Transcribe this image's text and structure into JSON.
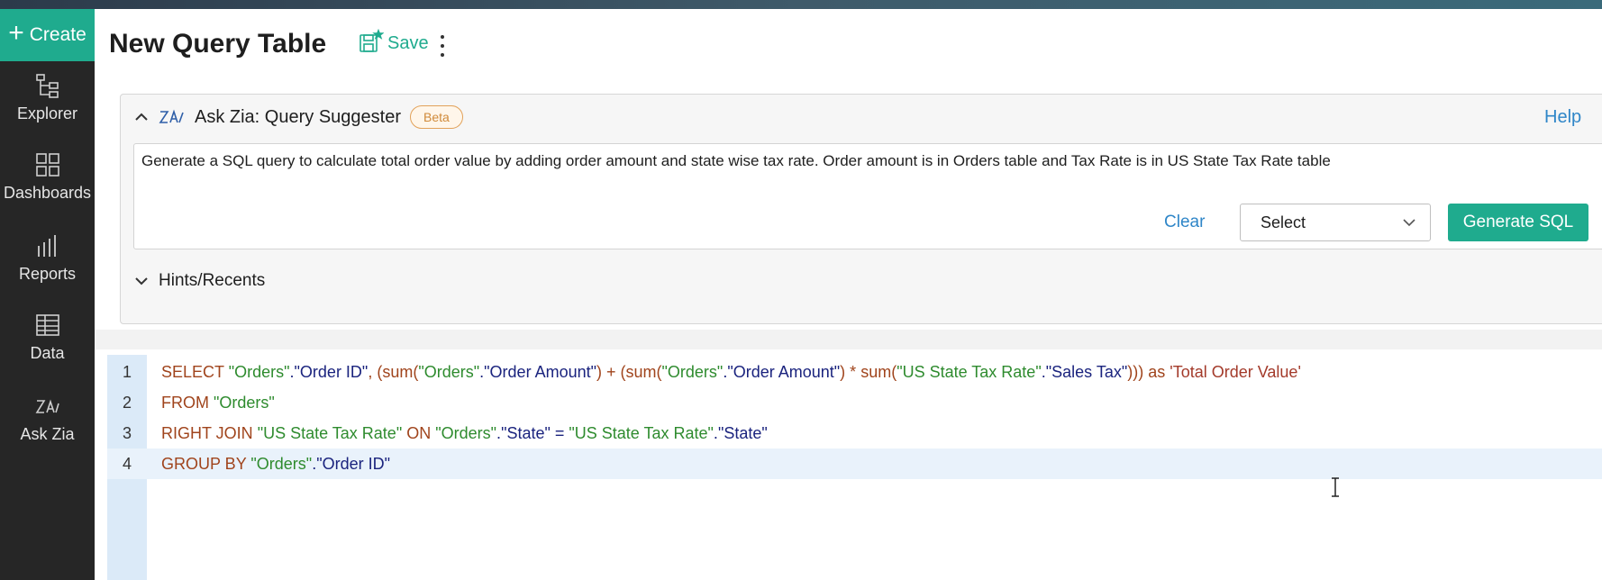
{
  "sidebar": {
    "create_label": "Create",
    "items": [
      {
        "label": "Explorer",
        "icon": "explorer-icon"
      },
      {
        "label": "Dashboards",
        "icon": "dashboards-icon"
      },
      {
        "label": "Reports",
        "icon": "reports-icon"
      },
      {
        "label": "Data",
        "icon": "data-icon"
      },
      {
        "label": "Ask Zia",
        "icon": "zia-icon"
      }
    ]
  },
  "header": {
    "title": "New Query Table",
    "save_label": "Save"
  },
  "zia": {
    "label": "Ask Zia: Query Suggester",
    "badge": "Beta",
    "help": "Help",
    "prompt": "Generate a SQL query to calculate total order value by adding order amount and state wise tax rate. Order amount is in Orders table and Tax Rate is in US State Tax Rate table",
    "clear": "Clear",
    "select_value": "Select",
    "generate": "Generate SQL",
    "hints": "Hints/Recents"
  },
  "editor": {
    "lines": [
      {
        "num": "1"
      },
      {
        "num": "2"
      },
      {
        "num": "3"
      },
      {
        "num": "4"
      }
    ],
    "tokens": {
      "select": "SELECT",
      "from": "FROM",
      "right_join": "RIGHT JOIN",
      "on": "ON",
      "group_by": "GROUP BY",
      "as": "as",
      "orders": "\"Orders\"",
      "dot": ".",
      "order_id": "\"Order ID\"",
      "comma": ", ",
      "open_sum": "(sum(",
      "sum": "sum(",
      "order_amount": "\"Order Amount\"",
      "plus": ") + ",
      "times": ") * ",
      "tax_table": "\"US State Tax Rate\"",
      "sales_tax": "\"Sales Tax\"",
      "close": ")))",
      "alias": "'Total Order Value'",
      "state": "\"State\"",
      "eq": " = "
    }
  }
}
